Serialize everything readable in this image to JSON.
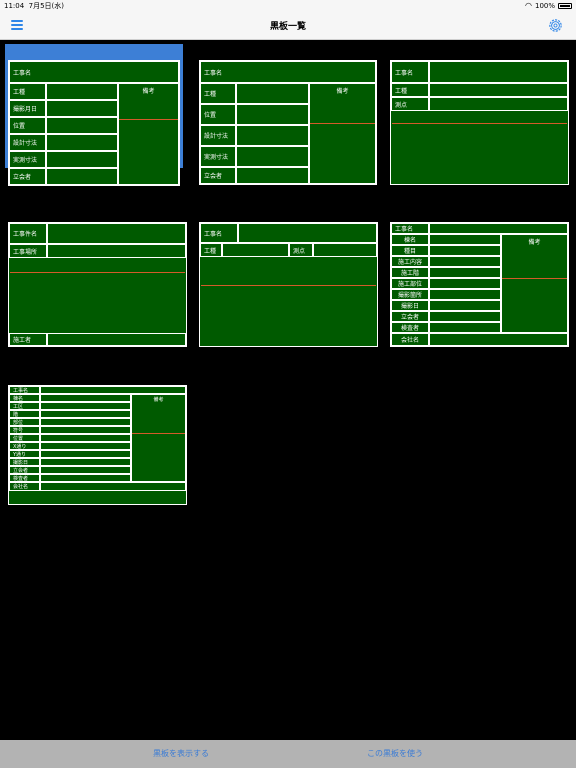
{
  "status": {
    "time": "11:04",
    "date": "7月5日(水)",
    "battery": "100%"
  },
  "nav": {
    "title": "黒板一覧"
  },
  "labels": {
    "koujimei": "工事名",
    "koushu": "工種",
    "satsueibi": "撮影月日",
    "ichi": "位置",
    "sekkei": "設計寸法",
    "jissoku": "実測寸法",
    "tachiai": "立会者",
    "bikou": "備考",
    "sokuten": "測点",
    "koujikenmei": "工事件名",
    "koujibasho": "工事場所",
    "sekousha": "施工者",
    "muname": "棟名",
    "shumoku": "種目",
    "sekounaiyou": "施工内容",
    "sekoukai": "施工階",
    "sekoubui": "施工部位",
    "satsueikasho": "撮影箇所",
    "satsueibi2": "撮影日",
    "kensasha": "検査者",
    "kaishamei": "会社名",
    "kouku": "工区",
    "kai": "階",
    "bui": "部位",
    "fugou": "符号",
    "xtoori": "X通り",
    "ytoori": "Y通り"
  },
  "bottom": {
    "show_label": "黒板を表示する",
    "use_label": "この黒板を使う"
  }
}
